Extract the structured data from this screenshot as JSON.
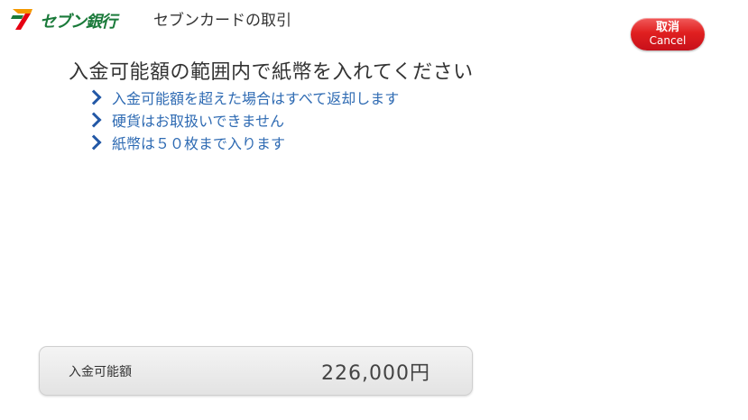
{
  "header": {
    "logo_text": "セブン銀行",
    "title": "セブンカードの取引"
  },
  "cancel_button": {
    "label_jp": "取消",
    "label_en": "Cancel",
    "color": "#e02020"
  },
  "main": {
    "instruction": "入金可能額の範囲内で紙幣を入れてください",
    "notes": [
      "入金可能額を超えた場合はすべて返却します",
      "硬貨はお取扱いできません",
      "紙幣は５０枚まで入ります"
    ]
  },
  "amount": {
    "label": "入金可能額",
    "value": "226,000円"
  },
  "colors": {
    "logo_green": "#1a7a3a",
    "logo_orange": "#f39800",
    "logo_red": "#e60012",
    "note_blue": "#2f6bb3"
  }
}
